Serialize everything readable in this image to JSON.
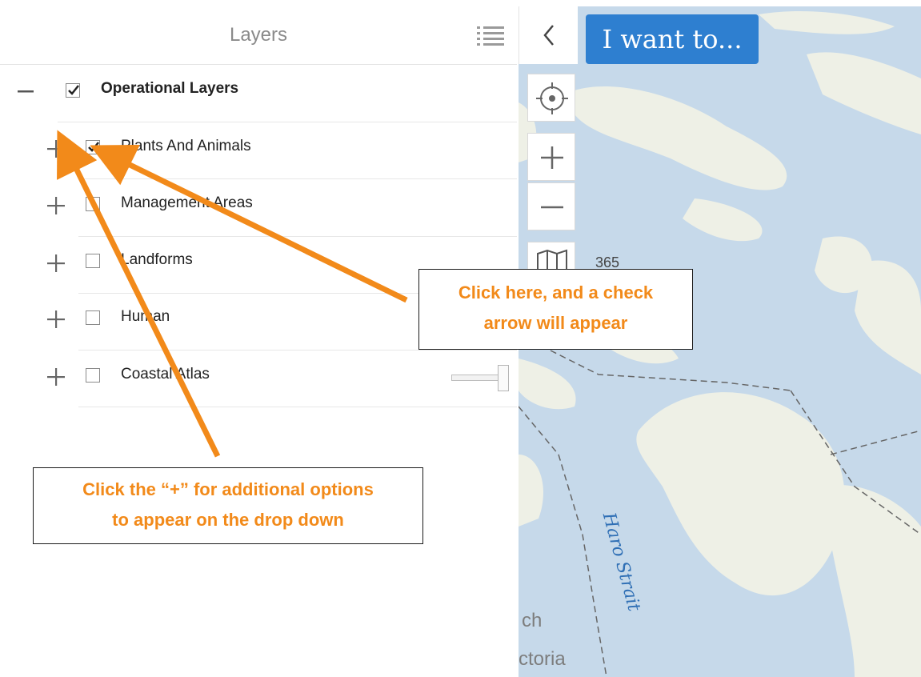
{
  "panel": {
    "title": "Layers",
    "list_icon": "list-icon"
  },
  "layers": {
    "root": {
      "label": "Operational Layers",
      "toggle": "−",
      "checked": true
    },
    "items": [
      {
        "label": "Plants And Animals",
        "toggle": "+",
        "checked": true
      },
      {
        "label": "Management Areas",
        "toggle": "+",
        "checked": false
      },
      {
        "label": "Landforms",
        "toggle": "+",
        "checked": false
      },
      {
        "label": "Human",
        "toggle": "+",
        "checked": false
      },
      {
        "label": "Coastal Atlas",
        "toggle": "+",
        "checked": false
      }
    ]
  },
  "map": {
    "i_want_button": "I want to...",
    "collapse_icon": "chevron-left-icon",
    "locate_icon": "crosshair-icon",
    "zoom_in_icon": "plus-icon",
    "zoom_out_icon": "minus-icon",
    "basemap_icon": "map-book-icon",
    "scale_number": "365",
    "strait_label": "Haro Strait",
    "edge_text_1": "ch",
    "edge_text_2": "ctoria"
  },
  "callouts": {
    "check_line1": "Click here, and a check",
    "check_line2": "arrow will appear",
    "plus_line1": "Click the “+” for additional options",
    "plus_line2": "to appear on the drop down"
  },
  "colors": {
    "accent_orange": "#f28a1a",
    "button_blue": "#2e7fd0",
    "water": "#c9dbea",
    "land": "#eef0e6"
  }
}
